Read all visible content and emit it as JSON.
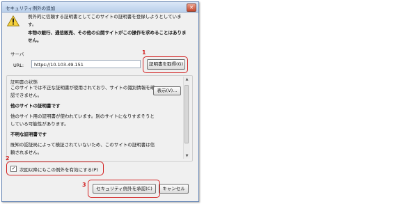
{
  "dialog": {
    "title": "セキュリティ例外の追加",
    "close_glyph": "✕",
    "warning_text": "例外的に信頼する証明書としてこのサイトの証明書を登録しようとしています。",
    "warning_bold": "本物の銀行、通信販売、その他の公開サイトがこの操作を求めることはありません。"
  },
  "server": {
    "section_label": "サーバ",
    "url_label": "URL:",
    "url_value": "https://10.103.49.151",
    "get_cert_button": "証明書を取得(G)"
  },
  "status": {
    "section_label": "証明書の状態",
    "view_button": "表示(V)...",
    "paragraphs": [
      {
        "text": "このサイトでは不正な証明書が使用されており、サイトの識別情報を確認できません。",
        "bold": false
      },
      {
        "text": "他のサイトの証明書です",
        "bold": true
      },
      {
        "text": "他のサイト用の証明書が使われています。別のサイトになりすまそうとしている可能性があります。",
        "bold": false
      },
      {
        "text": "不明な証明書です",
        "bold": true
      },
      {
        "text": "既知の認証局によって検証されていないため、このサイトの証明書は信頼されません。",
        "bold": false
      }
    ]
  },
  "permanent": {
    "checked": true,
    "check_glyph": "✓",
    "label": "次回以降にもこの例外を有効にする(P)"
  },
  "buttons": {
    "confirm": "セキュリティ例外を承認(C)",
    "cancel": "キャンセル"
  },
  "annotations": {
    "labels": [
      "1",
      "2",
      "3"
    ],
    "color": "#d22020"
  },
  "icons": {
    "warning": "warning-icon",
    "check": "check-icon",
    "scroll_up": "scroll-up-arrow-icon",
    "scroll_down": "scroll-down-arrow-icon"
  },
  "scroll_glyphs": {
    "up": "▲",
    "down": "▼"
  }
}
